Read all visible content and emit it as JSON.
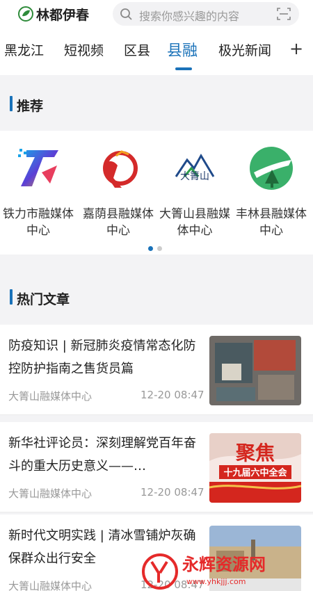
{
  "header": {
    "logo_text": "林都伊春",
    "search_placeholder": "搜索你感兴趣的内容"
  },
  "tabs": [
    {
      "label": "黑龙江"
    },
    {
      "label": "短视频"
    },
    {
      "label": "区县"
    },
    {
      "label": "县融"
    },
    {
      "label": "极光新闻"
    }
  ],
  "active_tab": "县融",
  "recommend": {
    "title": "推荐",
    "items": [
      {
        "name": "铁力市融媒体中心"
      },
      {
        "name": "嘉荫县融媒体中心"
      },
      {
        "name": "大箐山县融媒体中心",
        "logo_text": "大箐山"
      },
      {
        "name": "丰林县融媒体中心"
      }
    ],
    "page_count": 2,
    "current_page": 1
  },
  "hot": {
    "title": "热门文章",
    "articles": [
      {
        "title": "防疫知识 | 新冠肺炎疫情常态化防控防护指南之售货员篇",
        "source": "大箐山融媒体中心",
        "time": "12-20 08:47"
      },
      {
        "title": "新华社评论员：深刻理解党百年奋斗的重大历史意义——…",
        "source": "大箐山融媒体中心",
        "time": "12-20 08:47",
        "thumb_text_1": "聚焦",
        "thumb_text_2": "十九届六中全会"
      },
      {
        "title": "新时代文明实践 | 清冰雪铺炉灰确保群众出行安全",
        "source": "大箐山融媒体中心",
        "time": "12-20 08:47"
      }
    ]
  },
  "watermark": {
    "text": "永辉资源网",
    "url": "www.yhkjjj.com"
  },
  "colors": {
    "accent": "#1a72b9",
    "watermark": "#e52a2a"
  }
}
